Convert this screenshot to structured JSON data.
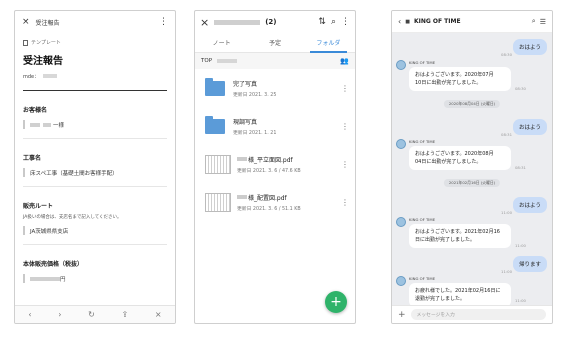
{
  "panel1": {
    "header_title": "受注報告",
    "close_icon": "×",
    "more_icon": "⋮",
    "template_label": "テンプレート",
    "report_heading": "受注報告",
    "mode_label": "mde：",
    "customer_label": "お客様名",
    "customer_suffix": "一様",
    "project_label": "工事名",
    "project_value": "床スペ工事（基礎土間お客様手配）",
    "route_label": "販売ルート",
    "route_hint": "JA扱いの場合は、支店名まで記入してください。",
    "route_value": "JA茨城県県支店",
    "price_label": "本体販売価格（税抜）",
    "price_suffix": "円",
    "bottom_nav": [
      "‹",
      "›",
      "↻",
      "⇪",
      "×"
    ]
  },
  "panel2": {
    "count": "(2)",
    "tabs": [
      "ノート",
      "予定",
      "フォルダ"
    ],
    "active_tab": "フォルダ",
    "breadcrumb_root": "TOP",
    "items": [
      {
        "type": "folder",
        "name": "完了写真",
        "meta": "更新日 2021. 3. 25"
      },
      {
        "type": "folder",
        "name": "現調写真",
        "meta": "更新日 2021. 1. 21"
      },
      {
        "type": "pdf",
        "name": "様_平立面図.pdf",
        "meta": "更新日 2021. 3. 6 / 47.6 KB"
      },
      {
        "type": "pdf",
        "name": "様_配置図.pdf",
        "meta": "更新日 2021. 3. 6 / 51.1 KB"
      }
    ],
    "fab_label": "+"
  },
  "panel3": {
    "title": "KING OF TIME",
    "input_placeholder": "メッセージを入力",
    "messages": {
      "out1": {
        "text": "おはよう",
        "time": "08:30"
      },
      "in1_sender": "KING OF TIME",
      "in1_line1": "おはようございます。2020年07月",
      "in1_line2": "10日に出勤が完了しました。",
      "in1_time": "08:30",
      "date1": "2020年08月04日 (火曜日)",
      "out2": {
        "text": "おはよう",
        "time": "08:31"
      },
      "in2_sender": "KING OF TIME",
      "in2_line1": "おはようございます。2020年08月",
      "in2_line2": "04日に出勤が完了しました。",
      "in2_time": "08:31",
      "date2": "2021年02月16日 (火曜日)",
      "out3": {
        "text": "おはよう",
        "time": "11:00"
      },
      "in3_sender": "KING OF TIME",
      "in3_line1": "おはようございます。2021年02月16",
      "in3_line2": "日に出勤が完了しました。",
      "in3_time": "11:00",
      "out4": {
        "text": "帰ります",
        "time": "11:00"
      },
      "in4_sender": "KING OF TIME",
      "in4_line1": "お疲れ様でした。2021年02月16日に",
      "in4_line2": "退勤が完了しました。",
      "in4_time": "11:00"
    }
  }
}
